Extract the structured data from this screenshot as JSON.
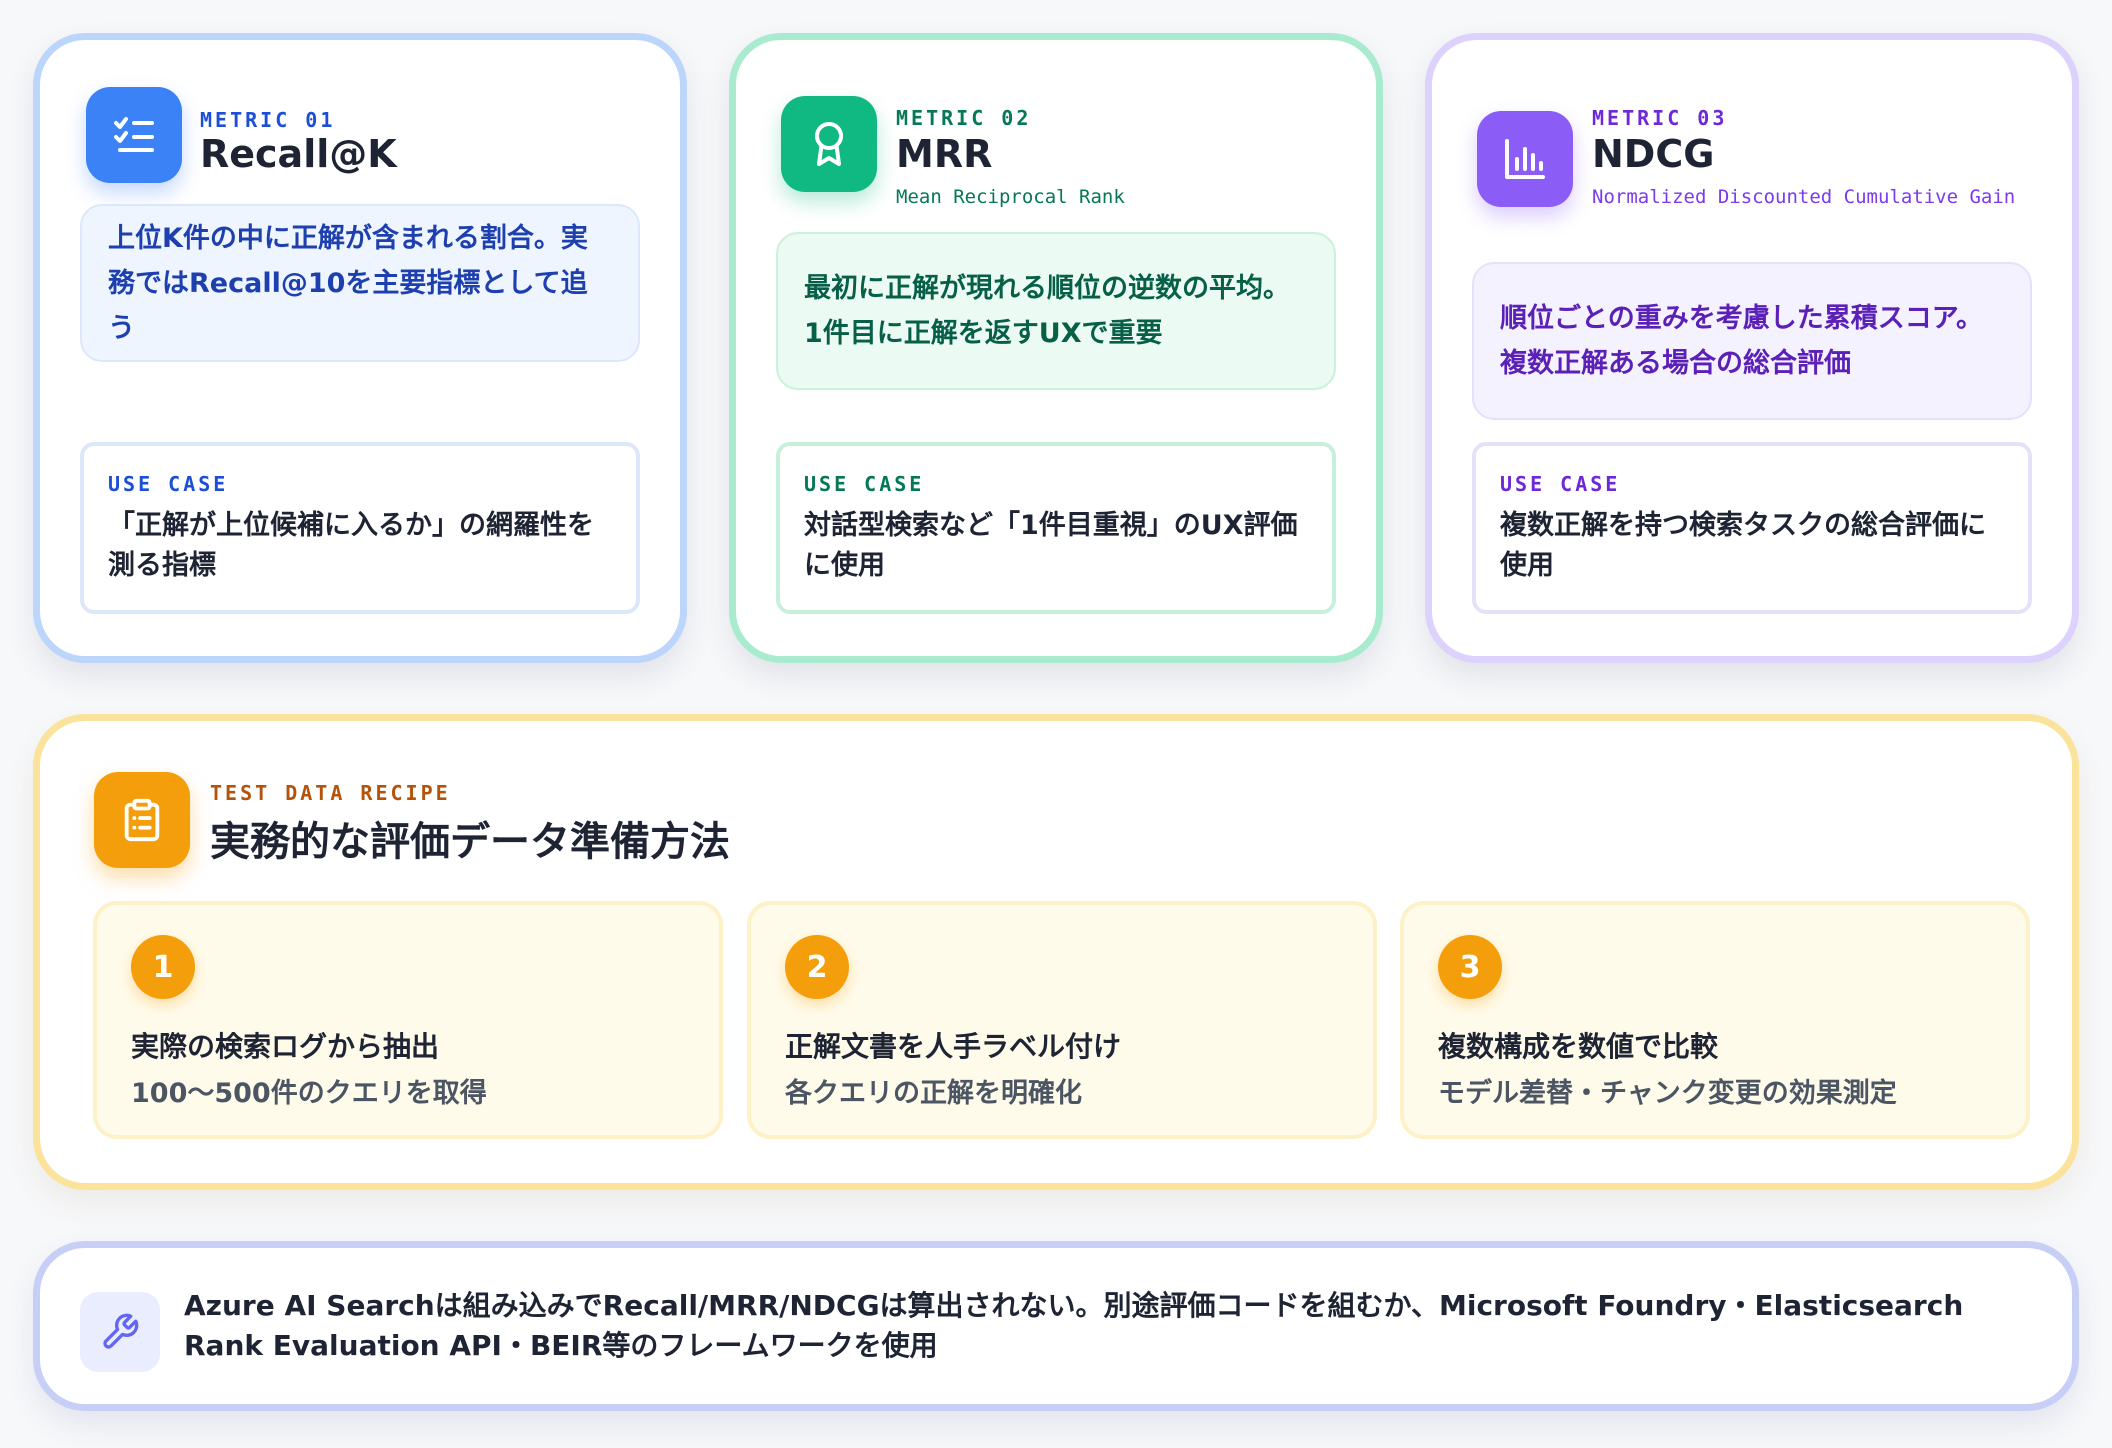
{
  "metrics": [
    {
      "eyebrow": "METRIC 01",
      "title": "Recall@K",
      "subtitle": "",
      "description": "上位K件の中に正解が含まれる割合。実務ではRecall@10を主要指標として追う",
      "use_case_label": "USE CASE",
      "use_case_text": "「正解が上位候補に入るか」の網羅性を測る指標",
      "icon": "checklist-icon",
      "accent": "#3b82f6"
    },
    {
      "eyebrow": "METRIC 02",
      "title": "MRR",
      "subtitle": "Mean Reciprocal Rank",
      "description": "最初に正解が現れる順位の逆数の平均。1件目に正解を返すUXで重要",
      "use_case_label": "USE CASE",
      "use_case_text": "対話型検索など「1件目重視」のUX評価に使用",
      "icon": "award-icon",
      "accent": "#10b981"
    },
    {
      "eyebrow": "METRIC 03",
      "title": "NDCG",
      "subtitle": "Normalized Discounted Cumulative Gain",
      "description": "順位ごとの重みを考慮した累積スコア。複数正解ある場合の総合評価",
      "use_case_label": "USE CASE",
      "use_case_text": "複数正解を持つ検索タスクの総合評価に使用",
      "icon": "bar-chart-icon",
      "accent": "#8b5cf6"
    }
  ],
  "recipe": {
    "eyebrow": "TEST DATA RECIPE",
    "title": "実務的な評価データ準備方法",
    "icon": "clipboard-icon",
    "accent": "#f59e0b",
    "steps": [
      {
        "number": "1",
        "title": "実際の検索ログから抽出",
        "description": "100〜500件のクエリを取得"
      },
      {
        "number": "2",
        "title": "正解文書を人手ラベル付け",
        "description": "各クエリの正解を明確化"
      },
      {
        "number": "3",
        "title": "複数構成を数値で比較",
        "description": "モデル差替・チャンク変更の効果測定"
      }
    ]
  },
  "note": {
    "icon": "wrench-icon",
    "text": "Azure AI Searchは組み込みでRecall/MRR/NDCGは算出されない。別途評価コードを組むか、Microsoft Foundry・Elasticsearch Rank Evaluation API・BEIR等のフレームワークを使用"
  }
}
